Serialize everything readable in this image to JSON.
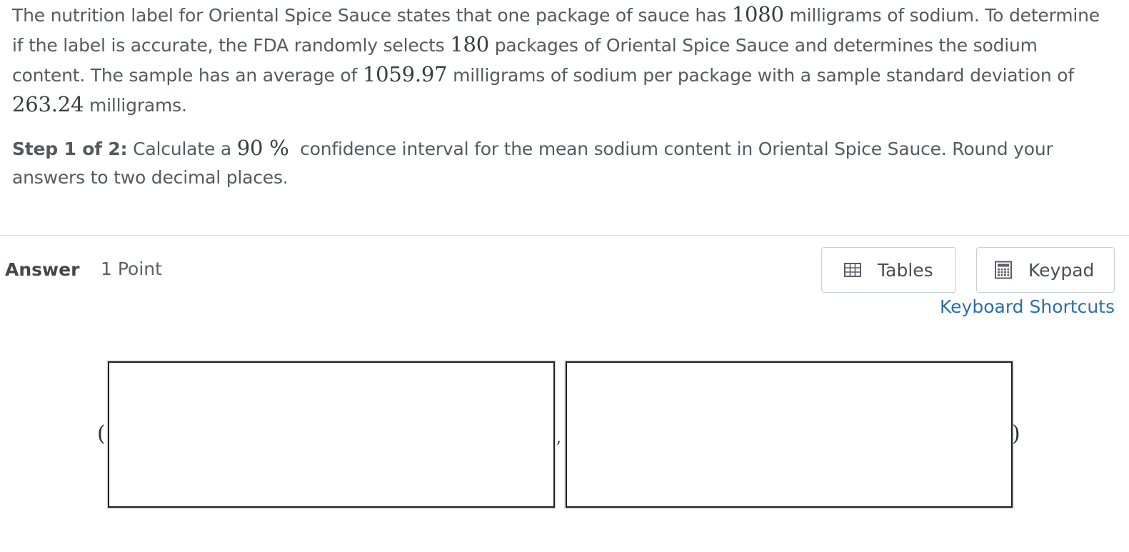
{
  "question": {
    "intro_1": "The nutrition label for Oriental Spice Sauce states that one package of sauce has ",
    "stated_sodium": "1080",
    "intro_2": " milligrams of sodium. To determine if the label is accurate, the FDA randomly selects ",
    "sample_size": "180",
    "intro_3": " packages of Oriental Spice Sauce and determines the sodium content. The sample has an average of ",
    "sample_mean": "1059.97",
    "intro_4": " milligrams of sodium per package with a sample standard deviation of ",
    "sample_sd": "263.24",
    "intro_5": " milligrams.",
    "step_label": "Step 1 of 2:",
    "step_text_1": " Calculate a ",
    "confidence": "90 %",
    "step_text_2": "  confidence interval for the mean sodium content in Oriental Spice Sauce. Round your answers to two decimal places."
  },
  "answer": {
    "label": "Answer",
    "points": "1 Point",
    "tables_button": "Tables",
    "keypad_button": "Keypad",
    "keyboard_shortcuts_link": "Keyboard Shortcuts",
    "open_paren": "(",
    "separator": ",",
    "close_paren": ")",
    "lower_bound_value": "",
    "upper_bound_value": ""
  },
  "icons": {
    "tables": "table-icon",
    "keypad": "calculator-icon"
  },
  "colors": {
    "text": "#555a60",
    "link": "#2c6ead",
    "divider": "#dcdfe3",
    "button_border": "#c9ced4"
  }
}
